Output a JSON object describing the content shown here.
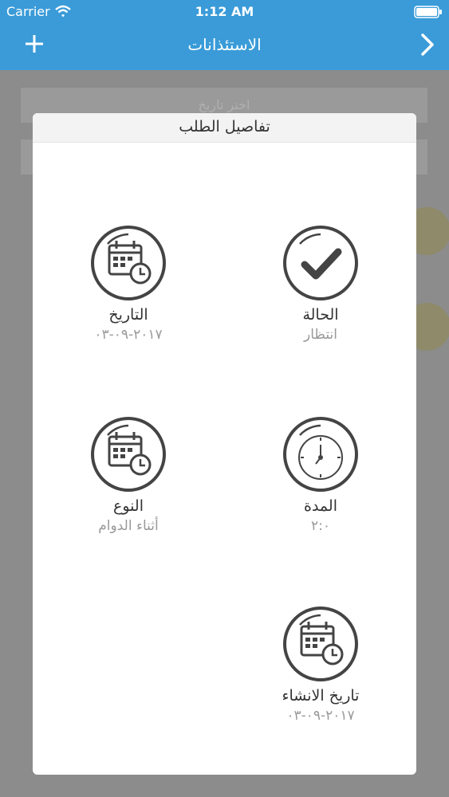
{
  "status_bar": {
    "carrier": "Carrier",
    "time": "1:12 AM"
  },
  "nav": {
    "title": "الاستئذانات",
    "add_icon": "plus-icon",
    "forward_icon": "chevron-right-icon"
  },
  "background": {
    "field_placeholder": "اختر تاريخ"
  },
  "modal": {
    "title": "تفاصيل الطلب",
    "items": [
      {
        "label": "الحالة",
        "value": "انتظار",
        "icon": "checkmark-icon"
      },
      {
        "label": "التاريخ",
        "value": "٢٠١٧-٠٩-٠٣",
        "icon": "calendar-clock-icon"
      },
      {
        "label": "المدة",
        "value": "٢:٠",
        "icon": "stopwatch-icon"
      },
      {
        "label": "النوع",
        "value": "أثناء الدوام",
        "icon": "calendar-clock-icon"
      },
      {
        "label": "تاريخ الانشاء",
        "value": "٢٠١٧-٠٩-٠٣",
        "icon": "calendar-clock-icon"
      }
    ]
  },
  "colors": {
    "nav_background": "#3a9bd8",
    "icon_stroke": "#444444",
    "value_text": "#999999"
  }
}
